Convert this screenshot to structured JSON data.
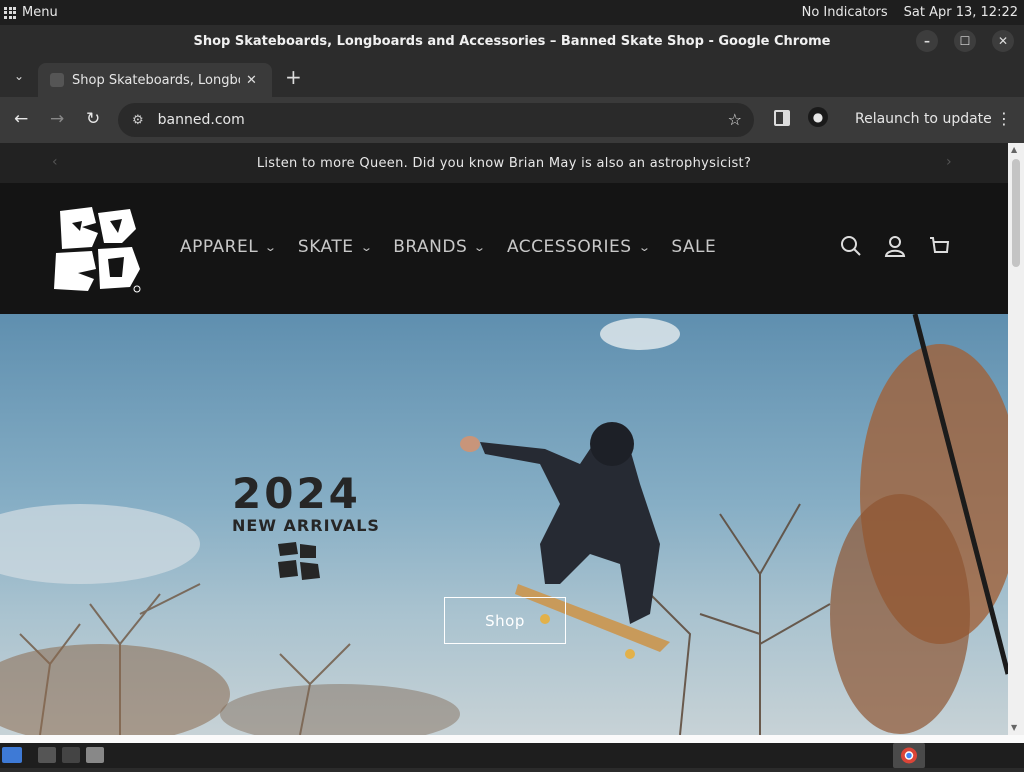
{
  "system_bar": {
    "menu_label": "Menu",
    "indicators": "No Indicators",
    "datetime": "Sat Apr 13, 12:22"
  },
  "window": {
    "title": "Shop Skateboards, Longboards and Accessories – Banned Skate Shop - Google Chrome"
  },
  "browser": {
    "tab_title": "Shop Skateboards, Longboards and Accessories – Banned Skate Shop",
    "url": "banned.com",
    "relaunch_label": "Relaunch to update"
  },
  "site": {
    "announcement": "Listen to more Queen. Did you know Brian May is also an astrophysicist?",
    "nav": [
      {
        "label": "APPAREL",
        "has_dropdown": true
      },
      {
        "label": "SKATE",
        "has_dropdown": true
      },
      {
        "label": "BRANDS",
        "has_dropdown": true
      },
      {
        "label": "ACCESSORIES",
        "has_dropdown": true
      },
      {
        "label": "SALE",
        "has_dropdown": false
      }
    ],
    "hero": {
      "year": "2024",
      "subtitle": "NEW ARRIVALS",
      "cta": "Shop"
    }
  },
  "icons": [
    "apps-grid-icon",
    "search-icon",
    "account-icon",
    "cart-icon",
    "star-icon",
    "side-panel-icon",
    "profile-icon",
    "kebab-menu-icon",
    "chrome-icon"
  ],
  "colors": {
    "header_bg": "#141414",
    "announce_bg": "#222222",
    "sky": "#86aec5"
  }
}
